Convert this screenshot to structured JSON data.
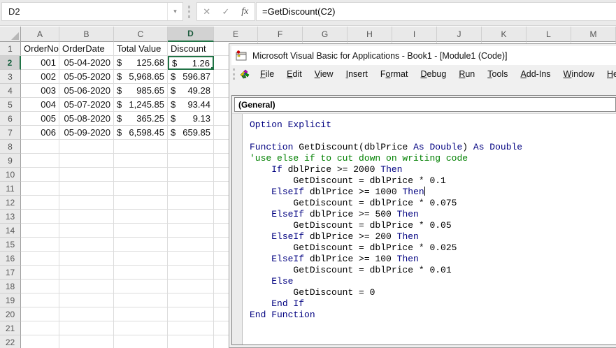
{
  "excel": {
    "name_box": {
      "value": "D2",
      "arrow": "▾"
    },
    "formula_bar": {
      "cancel": "✕",
      "enter": "✓",
      "fx": "fx",
      "formula": "=GetDiscount(C2)"
    },
    "columns": [
      "A",
      "B",
      "C",
      "D",
      "E",
      "F",
      "G",
      "H",
      "I",
      "J",
      "K",
      "L",
      "M"
    ],
    "selected": {
      "cell": "D2",
      "column": "D",
      "row": 2
    },
    "total_rows": 22,
    "header_row": {
      "A": "OrderNo",
      "B": "OrderDate",
      "C": "Total Value",
      "D": "Discount"
    },
    "rows": [
      {
        "row": 2,
        "order_no": "001",
        "order_date": "05-04-2020",
        "total_cur": "$",
        "total_val": "125.68",
        "disc_cur": "$",
        "disc_val": "1.26"
      },
      {
        "row": 3,
        "order_no": "002",
        "order_date": "05-05-2020",
        "total_cur": "$",
        "total_val": "5,968.65",
        "disc_cur": "$",
        "disc_val": "596.87"
      },
      {
        "row": 4,
        "order_no": "003",
        "order_date": "05-06-2020",
        "total_cur": "$",
        "total_val": "985.65",
        "disc_cur": "$",
        "disc_val": "49.28"
      },
      {
        "row": 5,
        "order_no": "004",
        "order_date": "05-07-2020",
        "total_cur": "$",
        "total_val": "1,245.85",
        "disc_cur": "$",
        "disc_val": "93.44"
      },
      {
        "row": 6,
        "order_no": "005",
        "order_date": "05-08-2020",
        "total_cur": "$",
        "total_val": "365.25",
        "disc_cur": "$",
        "disc_val": "9.13"
      },
      {
        "row": 7,
        "order_no": "006",
        "order_date": "05-09-2020",
        "total_cur": "$",
        "total_val": "6,598.45",
        "disc_cur": "$",
        "disc_val": "659.85"
      }
    ],
    "colors": {
      "selection_green": "#217346",
      "grid_line": "#dcdcdc",
      "header_bg": "#e9e9e9",
      "selected_header_bg": "#d2d2d2"
    }
  },
  "vba": {
    "title": "Microsoft Visual Basic for Applications - Book1 - [Module1 (Code)]",
    "menus": [
      {
        "label": "File",
        "u": 0
      },
      {
        "label": "Edit",
        "u": 0
      },
      {
        "label": "View",
        "u": 0
      },
      {
        "label": "Insert",
        "u": 0
      },
      {
        "label": "Format",
        "u": 1
      },
      {
        "label": "Debug",
        "u": 0
      },
      {
        "label": "Run",
        "u": 0
      },
      {
        "label": "Tools",
        "u": 0
      },
      {
        "label": "Add-Ins",
        "u": 0
      },
      {
        "label": "Window",
        "u": 0
      },
      {
        "label": "Help",
        "u": 0
      }
    ],
    "combo_left": "(General)",
    "code_colors": {
      "keyword": "#000080",
      "comment": "#008000",
      "plain": "#000000"
    },
    "code_lines": [
      [
        [
          "kw",
          "Option Explicit"
        ]
      ],
      [],
      [
        [
          "kw",
          "Function"
        ],
        [
          "pl",
          " GetDiscount(dblPrice "
        ],
        [
          "kw",
          "As Double"
        ],
        [
          "pl",
          ") "
        ],
        [
          "kw",
          "As Double"
        ]
      ],
      [
        [
          "cm",
          "'use else if to cut down on writing code"
        ]
      ],
      [
        [
          "pl",
          "    "
        ],
        [
          "kw",
          "If"
        ],
        [
          "pl",
          " dblPrice >= 2000 "
        ],
        [
          "kw",
          "Then"
        ]
      ],
      [
        [
          "pl",
          "        GetDiscount = dblPrice * 0.1"
        ]
      ],
      [
        [
          "pl",
          "    "
        ],
        [
          "kw",
          "ElseIf"
        ],
        [
          "pl",
          " dblPrice >= 1000 "
        ],
        [
          "kw",
          "Then"
        ],
        [
          "caret",
          ""
        ]
      ],
      [
        [
          "pl",
          "        GetDiscount = dblPrice * 0.075"
        ]
      ],
      [
        [
          "pl",
          "    "
        ],
        [
          "kw",
          "ElseIf"
        ],
        [
          "pl",
          " dblPrice >= 500 "
        ],
        [
          "kw",
          "Then"
        ]
      ],
      [
        [
          "pl",
          "        GetDiscount = dblPrice * 0.05"
        ]
      ],
      [
        [
          "pl",
          "    "
        ],
        [
          "kw",
          "ElseIf"
        ],
        [
          "pl",
          " dblPrice >= 200 "
        ],
        [
          "kw",
          "Then"
        ]
      ],
      [
        [
          "pl",
          "        GetDiscount = dblPrice * 0.025"
        ]
      ],
      [
        [
          "pl",
          "    "
        ],
        [
          "kw",
          "ElseIf"
        ],
        [
          "pl",
          " dblPrice >= 100 "
        ],
        [
          "kw",
          "Then"
        ]
      ],
      [
        [
          "pl",
          "        GetDiscount = dblPrice * 0.01"
        ]
      ],
      [
        [
          "pl",
          "    "
        ],
        [
          "kw",
          "Else"
        ]
      ],
      [
        [
          "pl",
          "        GetDiscount = 0"
        ]
      ],
      [
        [
          "pl",
          "    "
        ],
        [
          "kw",
          "End If"
        ]
      ],
      [
        [
          "kw",
          "End Function"
        ]
      ]
    ]
  }
}
